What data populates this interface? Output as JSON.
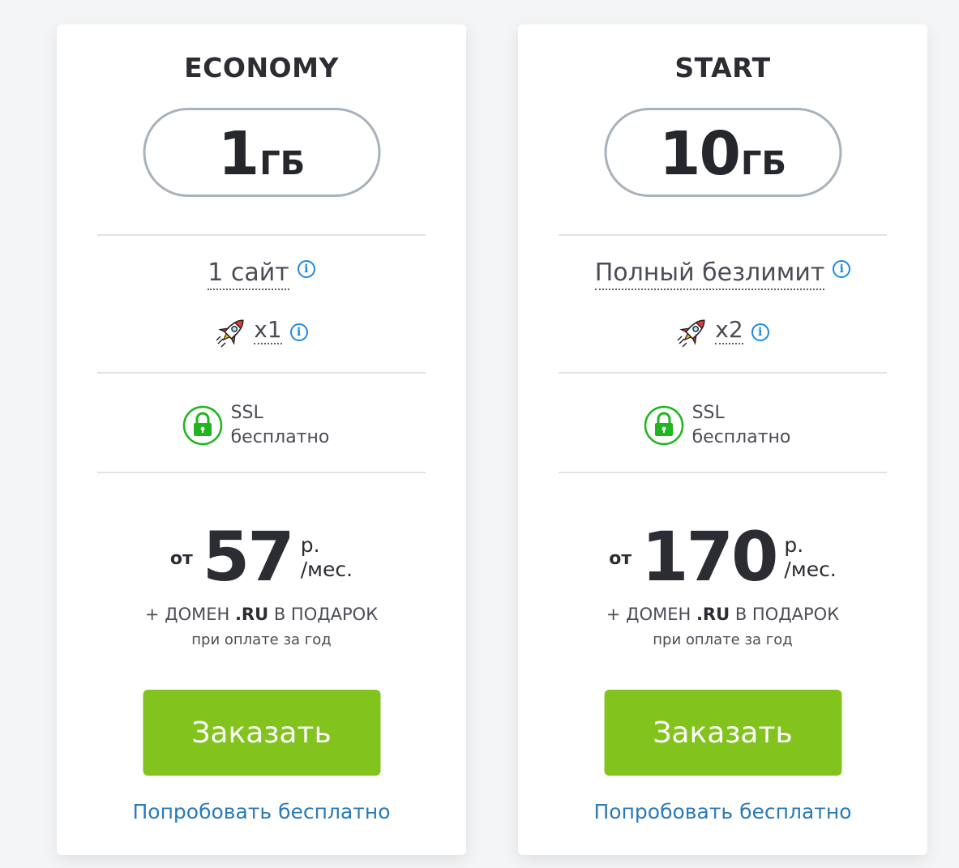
{
  "plans": [
    {
      "title": "ECONOMY",
      "disk_value": "1",
      "disk_unit": "ГБ",
      "sites": "1 сайт",
      "speed": "x1",
      "ssl_line1": "SSL",
      "ssl_line2": "бесплатно",
      "price_from": "от",
      "price": "57",
      "price_unit1": "р.",
      "price_unit2": "/мес.",
      "promo_prefix": "+ ДОМЕН ",
      "promo_domain": ".RU",
      "promo_suffix": " В ПОДАРОК",
      "promo_note": "при оплате за год",
      "order_label": "Заказать",
      "try_label": "Попробовать бесплатно"
    },
    {
      "title": "START",
      "disk_value": "10",
      "disk_unit": "ГБ",
      "sites": "Полный безлимит",
      "speed": "x2",
      "ssl_line1": "SSL",
      "ssl_line2": "бесплатно",
      "price_from": "от",
      "price": "170",
      "price_unit1": "р.",
      "price_unit2": "/мес.",
      "promo_prefix": "+ ДОМЕН ",
      "promo_domain": ".RU",
      "promo_suffix": " В ПОДАРОК",
      "promo_note": "при оплате за год",
      "order_label": "Заказать",
      "try_label": "Попробовать бесплатно"
    }
  ],
  "icons": {
    "info": "info-icon",
    "speed": "rocket-icon",
    "ssl": "lock-icon"
  },
  "colors": {
    "accent_green": "#82c31e",
    "ssl_green": "#1fb51f",
    "link_blue": "#2a7ab8",
    "info_blue": "#1e88e5"
  }
}
